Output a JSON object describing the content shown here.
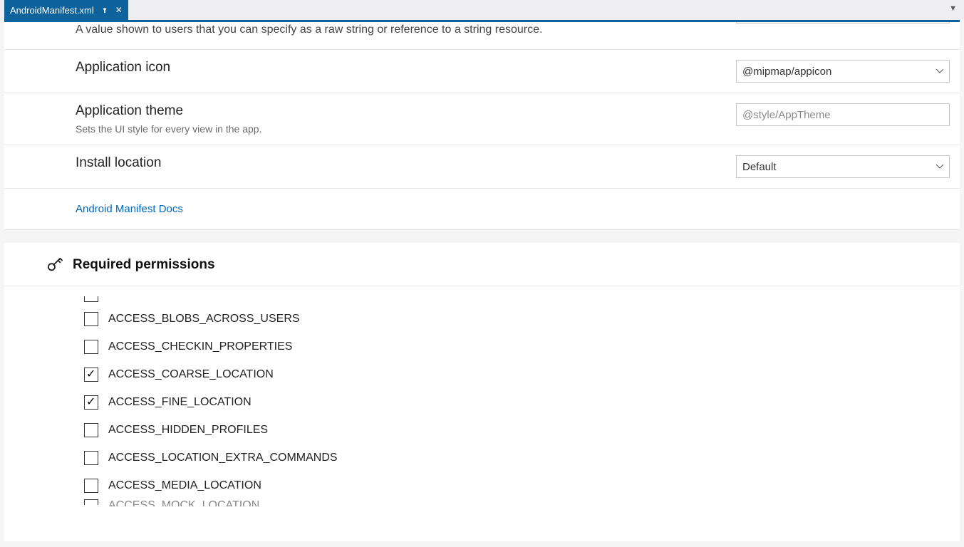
{
  "tab": {
    "title": "AndroidManifest.xml"
  },
  "cutoff_hint": "A value shown to users that you can specify as a raw string or reference to a string resource.",
  "fields": {
    "app_icon": {
      "label": "Application icon",
      "value": "@mipmap/appicon"
    },
    "app_theme": {
      "label": "Application theme",
      "hint": "Sets the UI style for every view in the app.",
      "placeholder": "@style/AppTheme",
      "value": ""
    },
    "install_location": {
      "label": "Install location",
      "value": "Default"
    }
  },
  "docs_link": "Android Manifest Docs",
  "permissions": {
    "header": "Required permissions",
    "items": [
      {
        "name": "ACCESS_BLOBS_ACROSS_USERS",
        "checked": false
      },
      {
        "name": "ACCESS_CHECKIN_PROPERTIES",
        "checked": false
      },
      {
        "name": "ACCESS_COARSE_LOCATION",
        "checked": true
      },
      {
        "name": "ACCESS_FINE_LOCATION",
        "checked": true
      },
      {
        "name": "ACCESS_HIDDEN_PROFILES",
        "checked": false
      },
      {
        "name": "ACCESS_LOCATION_EXTRA_COMMANDS",
        "checked": false
      },
      {
        "name": "ACCESS_MEDIA_LOCATION",
        "checked": false
      }
    ],
    "cut_bottom": "ACCESS_MOCK_LOCATION"
  }
}
